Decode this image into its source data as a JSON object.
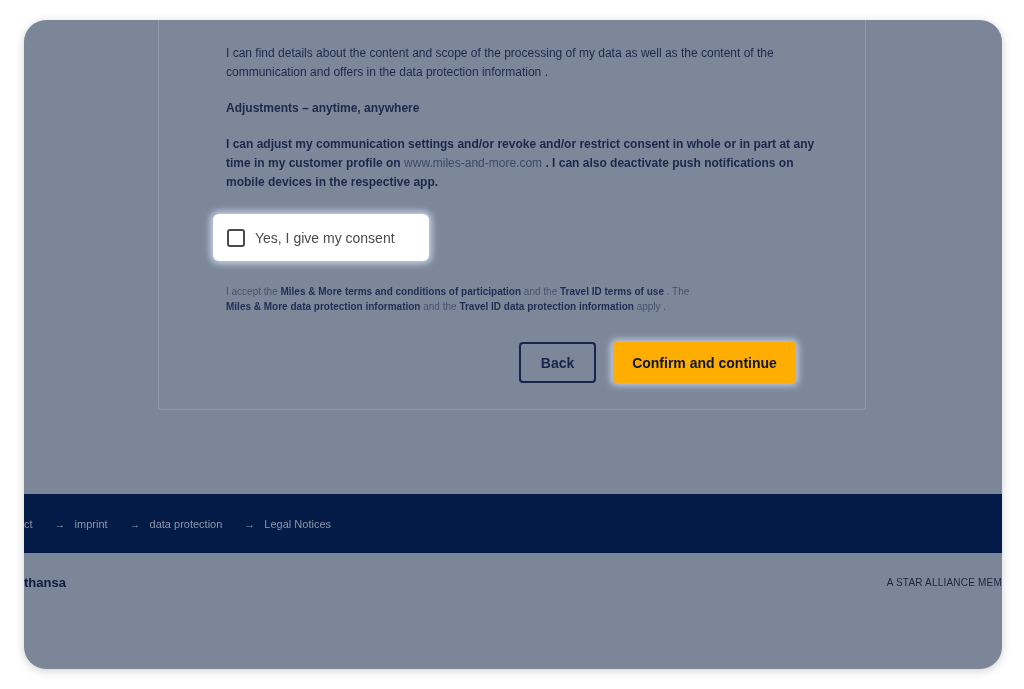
{
  "consent_card": {
    "paragraphs": [
      {
        "kind": "plain",
        "parts": [
          {
            "kind": "text",
            "text": "I can find details about the content and scope of the processing of my data as well as the content of the communication and offers in the data protection information ."
          }
        ]
      },
      {
        "kind": "heading",
        "parts": [
          {
            "kind": "text",
            "text": "Adjustments – anytime, anywhere"
          }
        ]
      },
      {
        "kind": "strong",
        "parts": [
          {
            "kind": "text",
            "text": "I can adjust my communication settings and/or revoke and/or restrict consent in whole or in part at any time in my customer profile on"
          },
          {
            "kind": "link",
            "text": "www.miles-and-more.com"
          },
          {
            "kind": "text",
            "text": ". I can also deactivate push notifications on mobile devices in the respective app."
          }
        ]
      }
    ],
    "consent": {
      "label": "Yes, I give my consent",
      "checked": false,
      "highlighted": true
    },
    "terms": {
      "parts": [
        {
          "kind": "text",
          "text": "I accept the"
        },
        {
          "kind": "link",
          "text": "Miles & More terms and conditions of participation"
        },
        {
          "kind": "text",
          "text": "and the"
        },
        {
          "kind": "link",
          "text": "Travel ID terms of use"
        },
        {
          "kind": "text",
          "text": ". The"
        },
        {
          "kind": "link",
          "text": "Miles & More data protection information"
        },
        {
          "kind": "text",
          "text": "and the"
        },
        {
          "kind": "link",
          "text": "Travel ID data protection information"
        },
        {
          "kind": "text",
          "text": "apply ."
        }
      ]
    },
    "buttons": [
      {
        "kind": "secondary",
        "label": "Back",
        "highlighted": false
      },
      {
        "kind": "primary",
        "label": "Confirm and continue",
        "highlighted": true
      }
    ]
  },
  "footer": {
    "links": [
      {
        "label": "ct"
      },
      {
        "arrow": "→",
        "label": "imprint"
      },
      {
        "arrow": "→",
        "label": "data protection"
      },
      {
        "arrow": "→",
        "label": "Legal Notices"
      }
    ]
  },
  "bottom_bar": {
    "brand": "thansa",
    "tagline": "A STAR ALLIANCE MEM"
  }
}
